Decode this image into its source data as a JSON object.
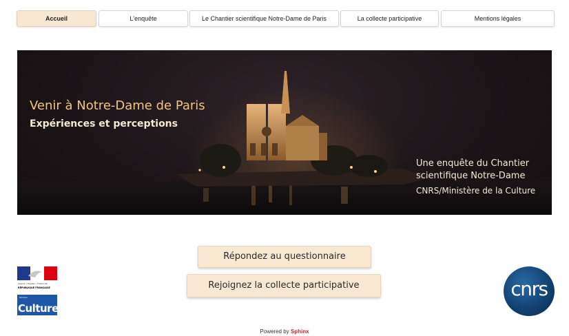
{
  "nav": {
    "tabs": [
      {
        "label": "Accueil",
        "active": true
      },
      {
        "label": "L'enquête",
        "active": false
      },
      {
        "label": "Le Chantier scientifique Notre-Dame de Paris",
        "active": false
      },
      {
        "label": "La collecte participative",
        "active": false
      },
      {
        "label": "Mentions légales",
        "active": false
      }
    ]
  },
  "hero": {
    "title": "Venir à Notre-Dame de Paris",
    "subtitle": "Expériences et perceptions",
    "credit_line1": "Une enquête du Chantier",
    "credit_line2": "scientifique Notre-Dame",
    "credit_line3": "CNRS/Ministère de la Culture"
  },
  "actions": {
    "questionnaire_label": "Répondez au questionnaire",
    "collecte_label": "Rejoignez la collecte participative"
  },
  "logos": {
    "rf_motto": "Liberté • Égalité • Fraternité",
    "rf_name": "RÉPUBLIQUE FRANÇAISE",
    "culture_small": "Ministère",
    "culture_big": "Culture",
    "cnrs": "cnrs"
  },
  "footer": {
    "powered_prefix": "Powered by",
    "powered_brand": "Sphinx"
  },
  "colors": {
    "active_tab": "#f6e7d1",
    "button_bg": "#f8e8d2",
    "hero_title": "#f2c57e",
    "hero_text": "#f4ead8",
    "culture_blue": "#1f56a8",
    "cnrs_blue": "#123f6d",
    "sphinx_red": "#b3322e"
  }
}
